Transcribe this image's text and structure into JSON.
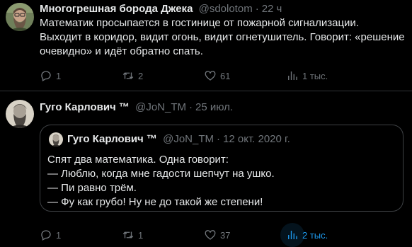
{
  "tweets": [
    {
      "author_name": "Многогрешная борода Джека",
      "handle": "@sdolotom",
      "separator": "·",
      "time": "22 ч",
      "lines": [
        "Математик просыпается в гостинице от пожарной сигнализации.",
        "Выходит в коридор, видит огонь, видит огнетушитель. Говорит: «решение",
        "очевидно» и идёт обратно спать."
      ],
      "replies": "1",
      "retweets": "2",
      "likes": "61",
      "views": "1 тыс."
    },
    {
      "author_name": "Гуго Карлович ™",
      "handle": "@JoN_TM",
      "separator": "·",
      "time": "25 июл.",
      "quote": {
        "author_name": "Гуго Карлович ™",
        "handle": "@JoN_TM",
        "separator": "·",
        "time": "12 окт. 2020 г.",
        "lines": [
          "Спят два математика. Одна говорит:",
          "— Люблю, когда мне гадости шепчут на ушко.",
          "— Пи равно трём.",
          "— Фу как грубо! Ну не до такой же степени!"
        ]
      },
      "replies": "1",
      "retweets": "1",
      "likes": "37",
      "views": "2 тыс."
    }
  ],
  "colors": {
    "background": "#000000",
    "text": "#e7e9ea",
    "muted": "#71767b",
    "accent": "#1d9bf0",
    "border": "#2f3336"
  },
  "icons": [
    "reply-icon",
    "retweet-icon",
    "like-icon",
    "views-icon"
  ]
}
